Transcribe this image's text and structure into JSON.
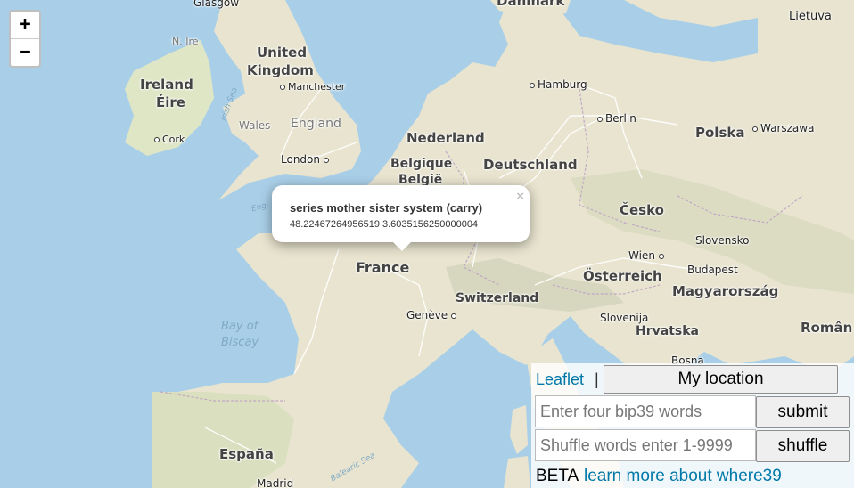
{
  "map": {
    "zoom_in": "+",
    "zoom_out": "−",
    "labels": {
      "glasgow": "Glasgow",
      "danmark": "Danmark",
      "lietuva": "Lietuva",
      "united_kingdom_1": "United",
      "united_kingdom_2": "Kingdom",
      "nire": "N. Ire",
      "ireland": "Ireland",
      "eire": "Éire",
      "irish_sea": "Irish Sea",
      "manchester": "Manchester",
      "hamburg": "Hamburg",
      "berlin": "Berlin",
      "polska": "Polska",
      "warszawa": "Warszawa",
      "wales": "Wales",
      "england": "England",
      "cork": "Cork",
      "nederland": "Nederland",
      "london": "London",
      "belgique": "Belgique",
      "belgie": "België",
      "deutschland": "Deutschland",
      "english_channel": "Engl",
      "cesko": "Česko",
      "slovensko": "Slovensko",
      "wien": "Wien",
      "budapest": "Budapest",
      "osterreich": "Österreich",
      "magyarorszag": "Magyarország",
      "france": "France",
      "switzerland": "Switzerland",
      "geneve": "Genève",
      "slovenija": "Slovenija",
      "hrvatska": "Hrvatska",
      "romania": "Român",
      "bay_1": "Bay of",
      "bay_2": "Biscay",
      "bosna": "Bosna",
      "espana": "España",
      "madrid": "Madrid",
      "balearic_sea": "Balearic Sea"
    }
  },
  "popup": {
    "title": "series mother sister system (carry)",
    "coords": "48.22467264956519 3.6035156250000004",
    "close": "×"
  },
  "panel": {
    "attribution": "Leaflet",
    "separator": "|",
    "my_location": "My location",
    "words_placeholder": "Enter four bip39 words",
    "submit": "submit",
    "shuffle_placeholder": "Shuffle words enter 1-9999",
    "shuffle": "shuffle",
    "beta": "BETA",
    "learn_more": "learn more about where39"
  }
}
